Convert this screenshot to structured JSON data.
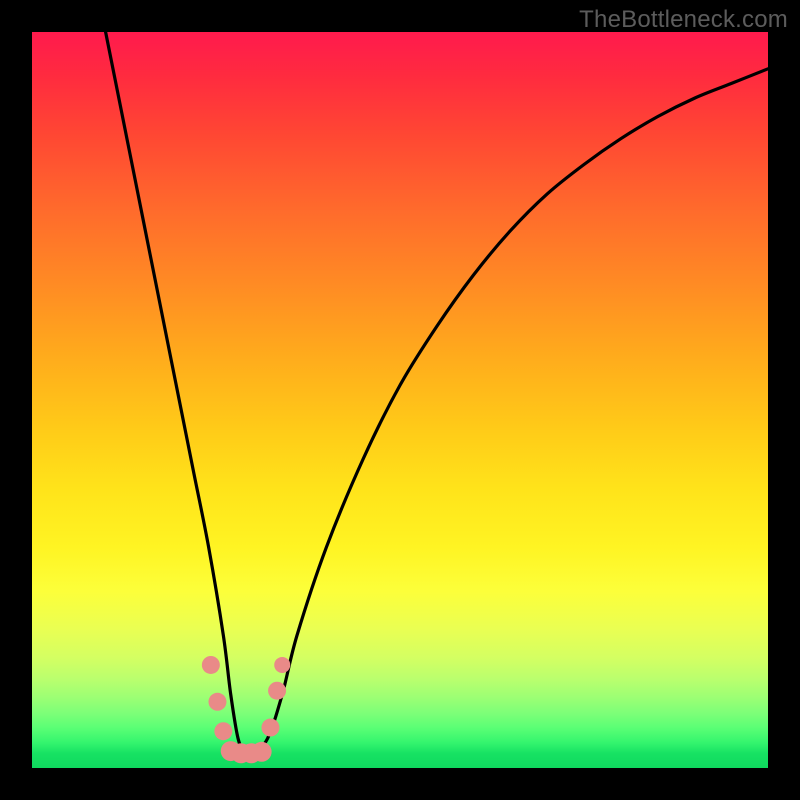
{
  "watermark": "TheBottleneck.com",
  "chart_data": {
    "type": "line",
    "title": "",
    "xlabel": "",
    "ylabel": "",
    "xlim": [
      0,
      100
    ],
    "ylim": [
      0,
      100
    ],
    "series": [
      {
        "name": "bottleneck-curve",
        "x": [
          10,
          12,
          14,
          16,
          18,
          20,
          22,
          24,
          26,
          27,
          28,
          29,
          30,
          32,
          34,
          36,
          40,
          45,
          50,
          55,
          60,
          65,
          70,
          75,
          80,
          85,
          90,
          95,
          100
        ],
        "y": [
          100,
          90,
          80,
          70,
          60,
          50,
          40,
          30,
          18,
          10,
          4,
          2,
          2,
          4,
          10,
          18,
          30,
          42,
          52,
          60,
          67,
          73,
          78,
          82,
          85.5,
          88.5,
          91,
          93,
          95
        ]
      }
    ],
    "markers": {
      "name": "highlight-dots",
      "color": "#e98a88",
      "points": [
        {
          "x": 24.3,
          "y": 14.0,
          "r": 9
        },
        {
          "x": 25.2,
          "y": 9.0,
          "r": 9
        },
        {
          "x": 26.0,
          "y": 5.0,
          "r": 9
        },
        {
          "x": 27.0,
          "y": 2.3,
          "r": 10
        },
        {
          "x": 28.4,
          "y": 2.0,
          "r": 10
        },
        {
          "x": 29.8,
          "y": 2.0,
          "r": 10
        },
        {
          "x": 31.2,
          "y": 2.2,
          "r": 10
        },
        {
          "x": 32.4,
          "y": 5.5,
          "r": 9
        },
        {
          "x": 33.3,
          "y": 10.5,
          "r": 9
        },
        {
          "x": 34.0,
          "y": 14.0,
          "r": 8
        }
      ]
    }
  }
}
